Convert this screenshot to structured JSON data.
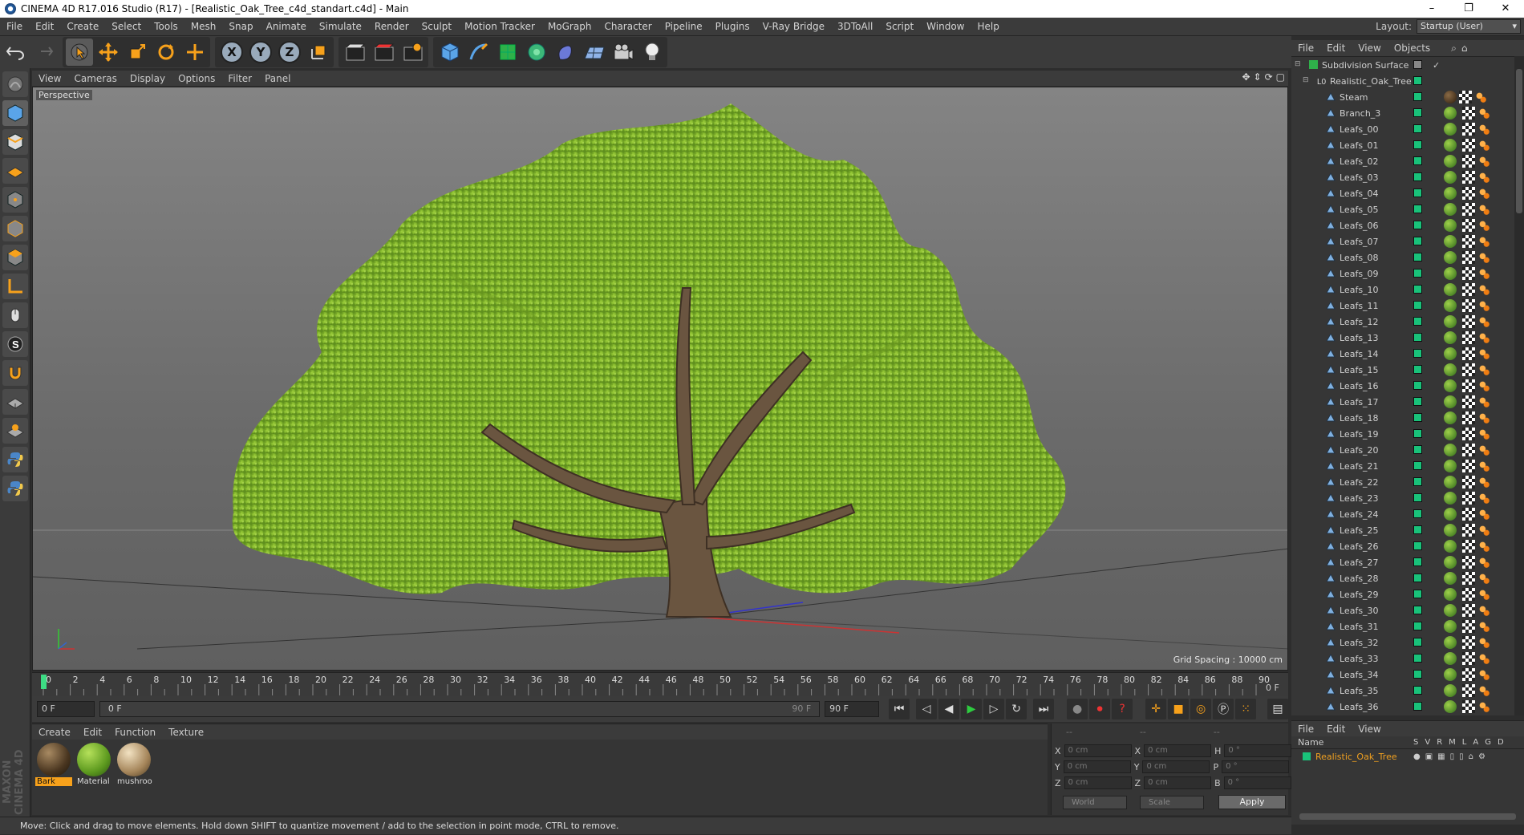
{
  "window": {
    "title": "CINEMA 4D R17.016 Studio (R17) - [Realistic_Oak_Tree_c4d_standart.c4d] - Main",
    "controls": [
      "–",
      "❐",
      "✕"
    ]
  },
  "menubar": {
    "items": [
      "File",
      "Edit",
      "Create",
      "Select",
      "Tools",
      "Mesh",
      "Snap",
      "Animate",
      "Simulate",
      "Render",
      "Sculpt",
      "Motion Tracker",
      "MoGraph",
      "Character",
      "Pipeline",
      "Plugins",
      "V-Ray Bridge",
      "3DToAll",
      "Script",
      "Window",
      "Help"
    ],
    "layout_label": "Layout:",
    "layout_value": "Startup (User)"
  },
  "toolbar": {
    "axis_labels": [
      "X",
      "Y",
      "Z"
    ]
  },
  "viewport": {
    "menu": [
      "View",
      "Cameras",
      "Display",
      "Options",
      "Filter",
      "Panel"
    ],
    "label": "Perspective",
    "grid_spacing": "Grid Spacing : 10000 cm"
  },
  "timeline": {
    "ticks": [
      "0",
      "2",
      "4",
      "6",
      "8",
      "10",
      "12",
      "14",
      "16",
      "18",
      "20",
      "22",
      "24",
      "26",
      "28",
      "30",
      "32",
      "34",
      "36",
      "38",
      "40",
      "42",
      "44",
      "46",
      "48",
      "50",
      "52",
      "54",
      "56",
      "58",
      "60",
      "62",
      "64",
      "66",
      "68",
      "70",
      "72",
      "74",
      "76",
      "78",
      "80",
      "82",
      "84",
      "86",
      "88",
      "90"
    ],
    "current_frame": "0 F",
    "right_frame": "0 F"
  },
  "transport": {
    "start_field": "0 F",
    "range_start": "0 F",
    "range_end": "90 F",
    "end_field": "90 F"
  },
  "materials": {
    "menu": [
      "Create",
      "Edit",
      "Function",
      "Texture"
    ],
    "items": [
      {
        "name": "Bark",
        "selected": true
      },
      {
        "name": "Material",
        "selected": false
      },
      {
        "name": "mushroo",
        "selected": false
      }
    ]
  },
  "coordinates": {
    "header_dashes": [
      "--",
      "--",
      "--"
    ],
    "rows": [
      {
        "a": "X",
        "av": "0 cm",
        "b": "X",
        "bv": "0 cm",
        "c": "H",
        "cv": "0 °"
      },
      {
        "a": "Y",
        "av": "0 cm",
        "b": "Y",
        "bv": "0 cm",
        "c": "P",
        "cv": "0 °"
      },
      {
        "a": "Z",
        "av": "0 cm",
        "b": "Z",
        "bv": "0 cm",
        "c": "B",
        "cv": "0 °"
      }
    ],
    "dropdown_world": "World",
    "dropdown_scale": "Scale",
    "apply": "Apply"
  },
  "objects_panel": {
    "menu": [
      "File",
      "Edit",
      "View",
      "Objects"
    ],
    "root": "Subdivision Surface",
    "group": "Realistic_Oak_Tree",
    "children": [
      "Steam",
      "Branch_3",
      "Leafs_00",
      "Leafs_01",
      "Leafs_02",
      "Leafs_03",
      "Leafs_04",
      "Leafs_05",
      "Leafs_06",
      "Leafs_07",
      "Leafs_08",
      "Leafs_09",
      "Leafs_10",
      "Leafs_11",
      "Leafs_12",
      "Leafs_13",
      "Leafs_14",
      "Leafs_15",
      "Leafs_16",
      "Leafs_17",
      "Leafs_18",
      "Leafs_19",
      "Leafs_20",
      "Leafs_21",
      "Leafs_22",
      "Leafs_23",
      "Leafs_24",
      "Leafs_25",
      "Leafs_26",
      "Leafs_27",
      "Leafs_28",
      "Leafs_29",
      "Leafs_30",
      "Leafs_31",
      "Leafs_32",
      "Leafs_33",
      "Leafs_34",
      "Leafs_35",
      "Leafs_36"
    ]
  },
  "layers_panel": {
    "menu": [
      "File",
      "Edit",
      "View"
    ],
    "name_col": "Name",
    "cols": [
      "S",
      "V",
      "R",
      "M",
      "L",
      "A",
      "G",
      "D"
    ],
    "row": "Realistic_Oak_Tree"
  },
  "status": "Move: Click and drag to move elements. Hold down SHIFT to quantize movement / add to the selection in point mode, CTRL to remove.",
  "branding": "MAXON CINEMA 4D",
  "colors": {
    "accent": "#f7a11b",
    "layer_green": "#19c27a",
    "foliage": "#8fc23a"
  }
}
